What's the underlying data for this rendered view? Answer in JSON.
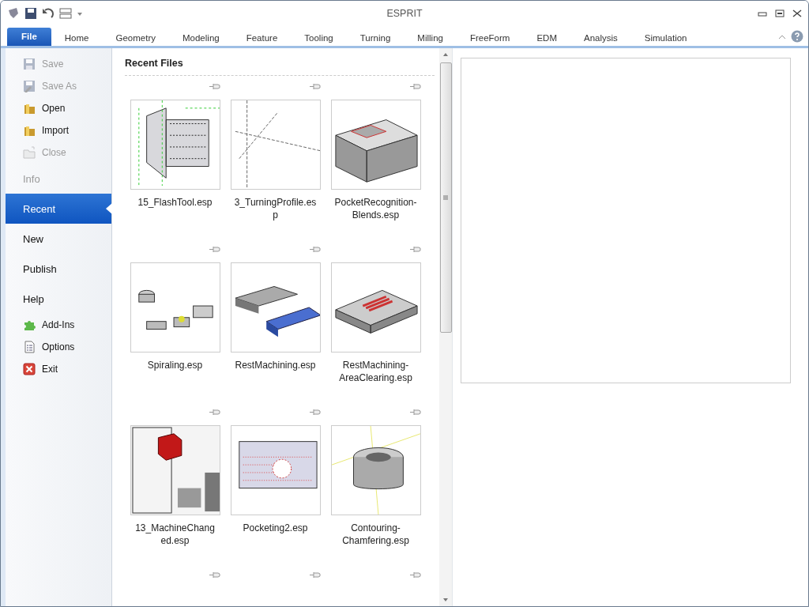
{
  "window": {
    "title": "ESPRIT"
  },
  "tabs": [
    {
      "label": "File",
      "selected": true
    },
    {
      "label": "Home",
      "selected": false
    },
    {
      "label": "Geometry",
      "selected": false
    },
    {
      "label": "Modeling",
      "selected": false
    },
    {
      "label": "Feature",
      "selected": false
    },
    {
      "label": "Tooling",
      "selected": false
    },
    {
      "label": "Turning",
      "selected": false
    },
    {
      "label": "Milling",
      "selected": false
    },
    {
      "label": "FreeForm",
      "selected": false
    },
    {
      "label": "EDM",
      "selected": false
    },
    {
      "label": "Analysis",
      "selected": false
    },
    {
      "label": "Simulation",
      "selected": false
    }
  ],
  "sidebar": {
    "items": [
      {
        "kind": "command",
        "label": "Save",
        "disabled": true
      },
      {
        "kind": "command",
        "label": "Save As",
        "disabled": true
      },
      {
        "kind": "command",
        "label": "Open",
        "disabled": false
      },
      {
        "kind": "command",
        "label": "Import",
        "disabled": false
      },
      {
        "kind": "command",
        "label": "Close",
        "disabled": true
      },
      {
        "kind": "section",
        "label": "Info",
        "disabled": true,
        "selected": false
      },
      {
        "kind": "section",
        "label": "Recent",
        "disabled": false,
        "selected": true
      },
      {
        "kind": "section",
        "label": "New",
        "disabled": false,
        "selected": false
      },
      {
        "kind": "section",
        "label": "Publish",
        "disabled": false,
        "selected": false
      },
      {
        "kind": "section",
        "label": "Help",
        "disabled": false,
        "selected": false
      },
      {
        "kind": "command",
        "label": "Add-Ins",
        "disabled": false
      },
      {
        "kind": "command",
        "label": "Options",
        "disabled": false
      },
      {
        "kind": "command",
        "label": "Exit",
        "disabled": false
      }
    ]
  },
  "recent": {
    "title": "Recent Files",
    "files": [
      {
        "name": "15_FlashTool.esp"
      },
      {
        "name": "3_TurningProfile.esp"
      },
      {
        "name": "PocketRecognition-Blends.esp"
      },
      {
        "name": "Spiraling.esp"
      },
      {
        "name": "RestMachining.esp"
      },
      {
        "name": "RestMachining-AreaClearing.esp"
      },
      {
        "name": "13_MachineChanged.esp"
      },
      {
        "name": "Pocketing2.esp"
      },
      {
        "name": "Contouring-Chamfering.esp"
      }
    ]
  }
}
